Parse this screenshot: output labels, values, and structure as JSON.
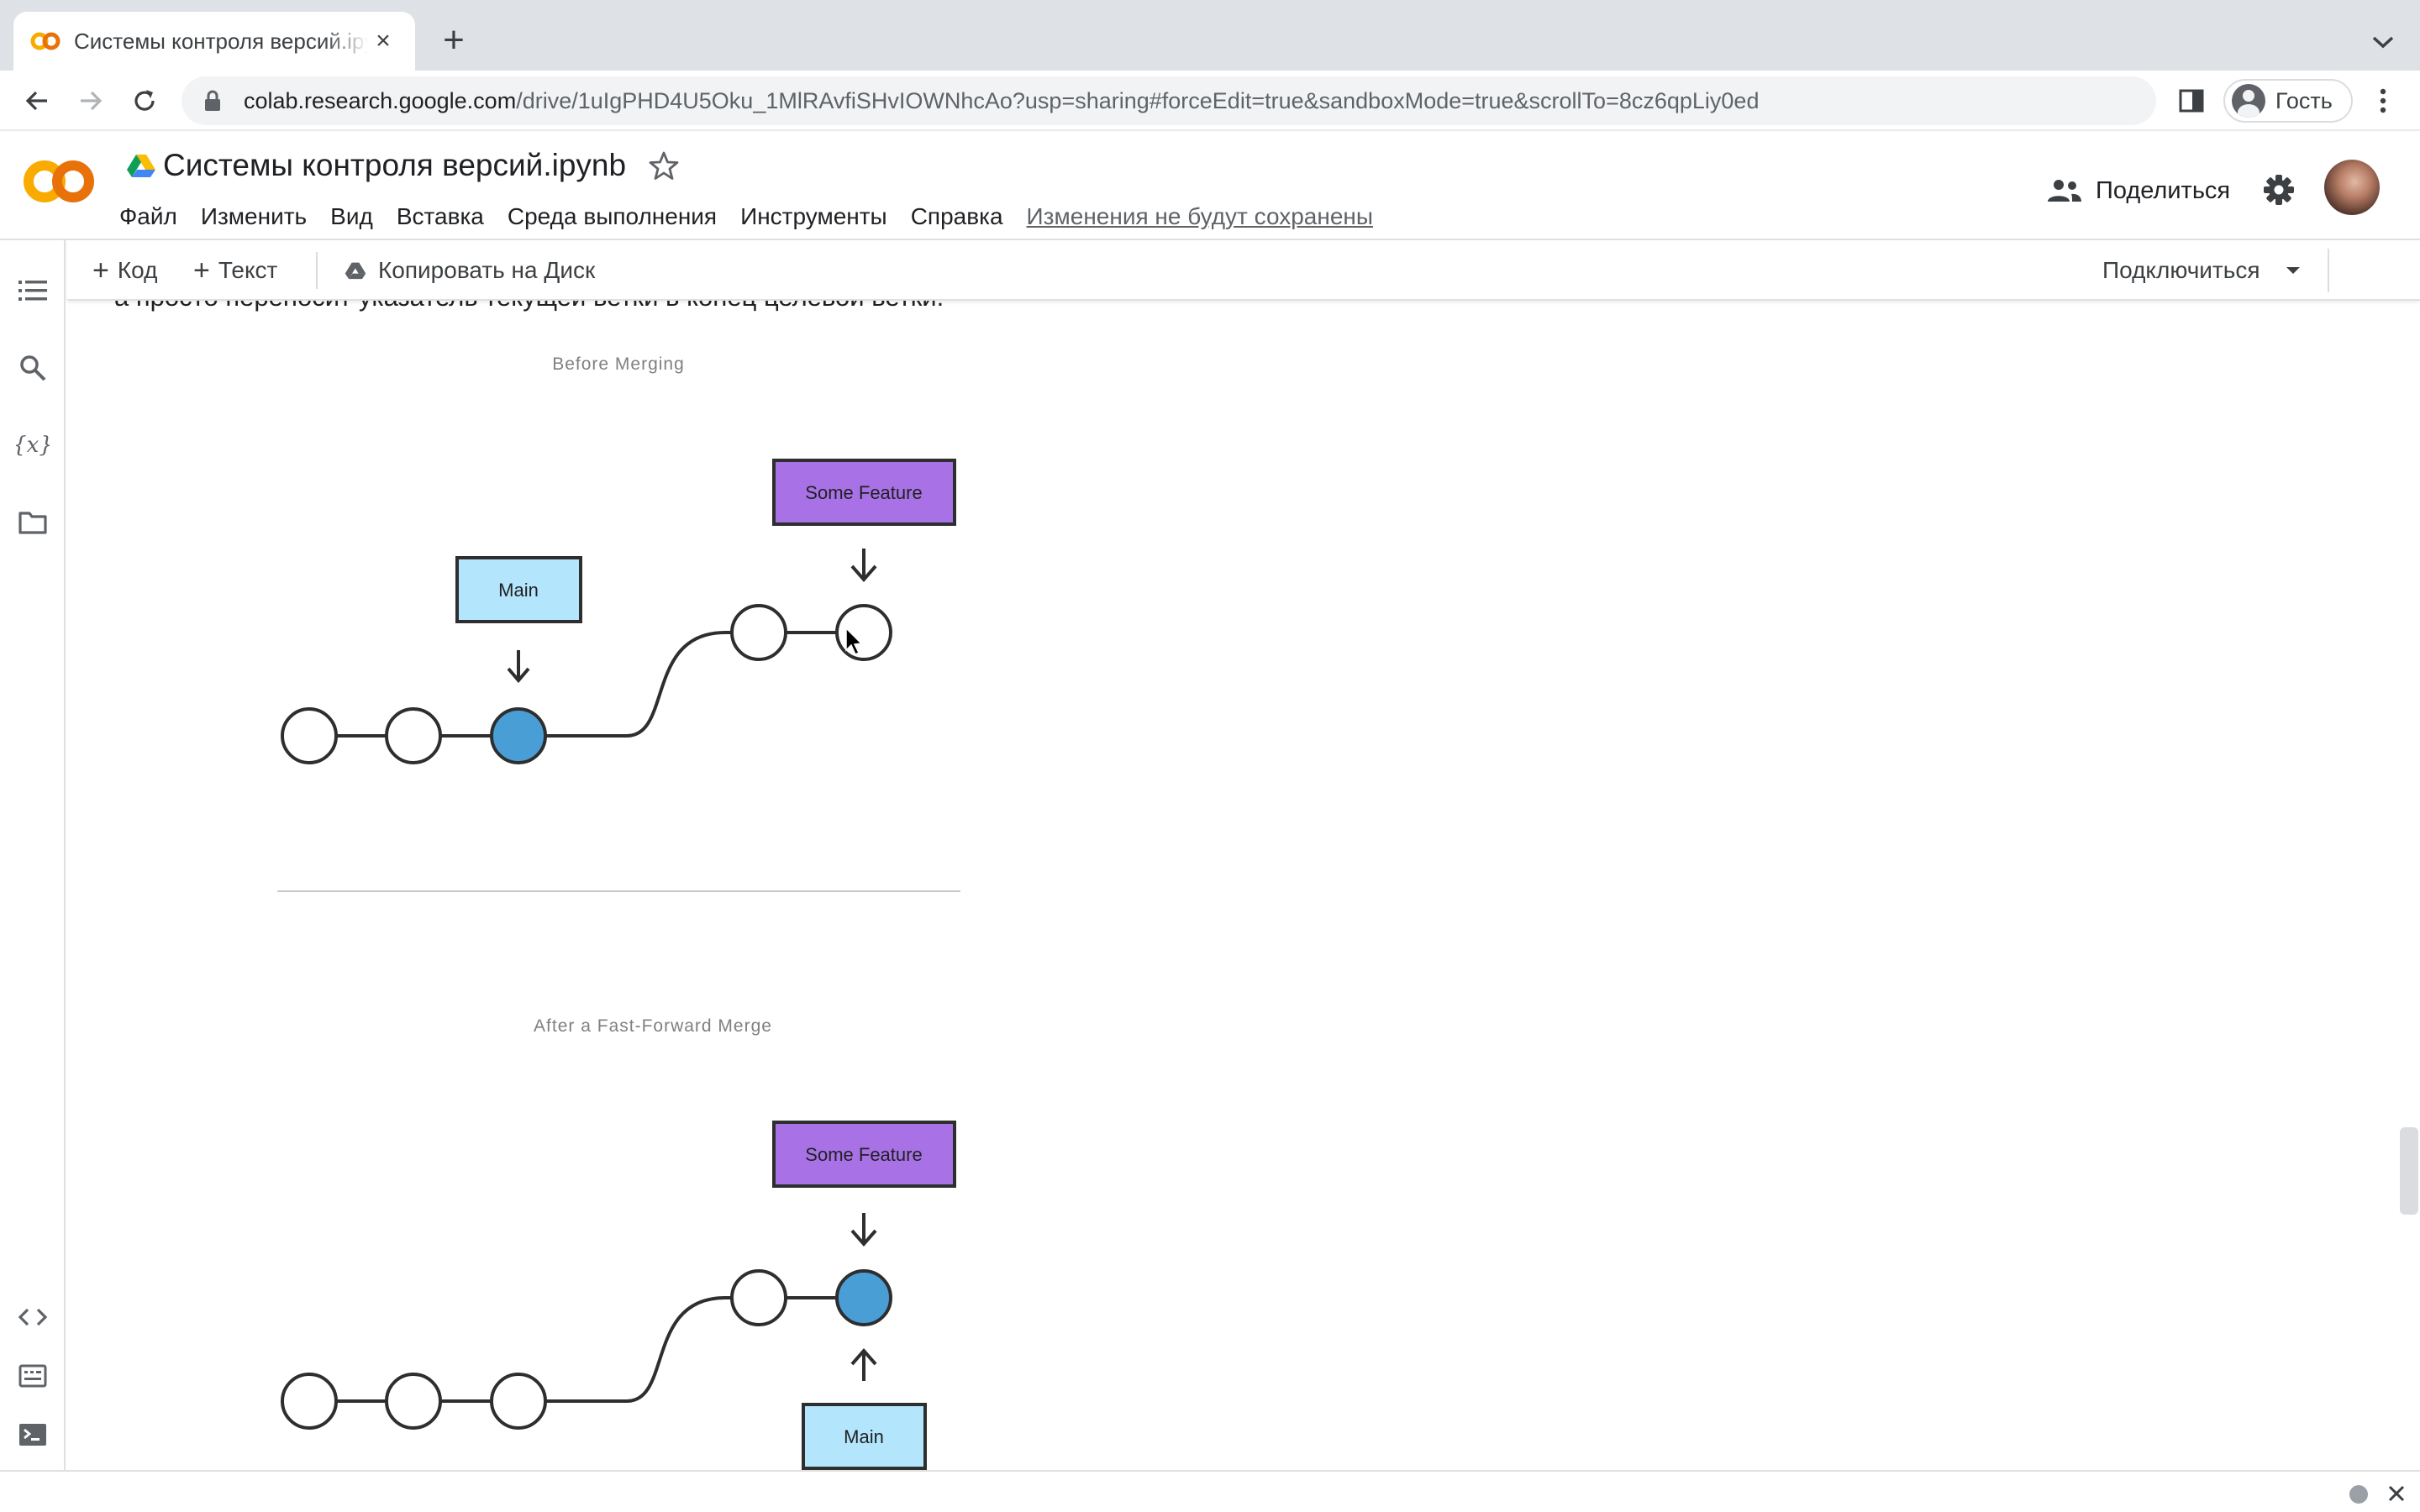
{
  "browser": {
    "tab_title": "Системы контроля версий.ipynb - Colaboratory",
    "new_tab_symbol": "+",
    "close_symbol": "×",
    "url_host": "colab.research.google.com",
    "url_path": "/drive/1uIgPHD4U5Oku_1MlRAvfiSHvIOWNhcAo?usp=sharing#forceEdit=true&sandboxMode=true&scrollTo=8cz6qpLiy0ed",
    "profile_label": "Гость"
  },
  "colab": {
    "doc_title": "Системы контроля версий.ipynb",
    "menu": [
      "Файл",
      "Изменить",
      "Вид",
      "Вставка",
      "Среда выполнения",
      "Инструменты",
      "Справка"
    ],
    "unsaved_notice": "Изменения не будут сохранены",
    "share_label": "Поделиться"
  },
  "notebook_toolbar": {
    "add_code": "Код",
    "add_text": "Текст",
    "copy_to_drive": "Копировать на Диск",
    "connect": "Подключиться"
  },
  "cell": {
    "cut_text": "а просто переносит указатель текущей ветки в конец целевой ветки."
  },
  "diagram": {
    "before_title": "Before Merging",
    "after_title": "After a Fast-Forward Merge",
    "main_label": "Main",
    "feature_label": "Some Feature",
    "colors": {
      "main_box": "#b3e5fc",
      "feature_box": "#a872e6",
      "active_commit": "#4a9ed6",
      "stroke": "#2e2e2e",
      "caption": "#808080"
    }
  },
  "icons": {
    "rail": [
      "table-of-contents-icon",
      "search-icon",
      "variables-icon",
      "files-icon",
      "code-snippets-icon",
      "command-palette-icon",
      "terminal-icon"
    ]
  }
}
